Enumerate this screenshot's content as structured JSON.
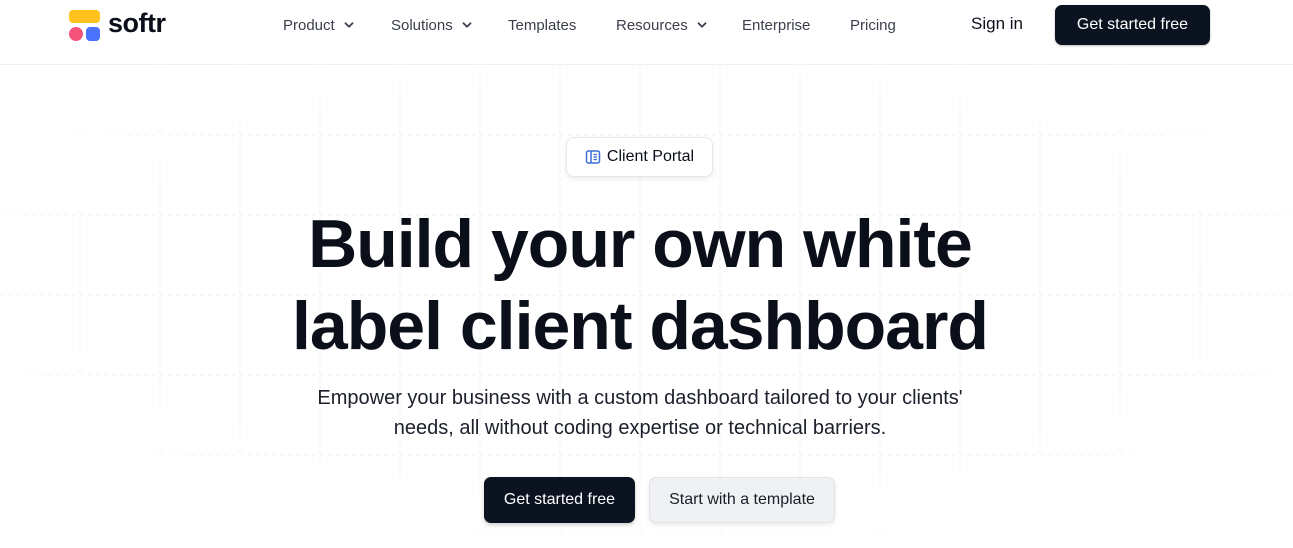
{
  "header": {
    "logo_text": "softr",
    "nav": [
      {
        "label": "Product",
        "has_dropdown": true
      },
      {
        "label": "Solutions",
        "has_dropdown": true
      },
      {
        "label": "Templates",
        "has_dropdown": false
      },
      {
        "label": "Resources",
        "has_dropdown": true
      },
      {
        "label": "Enterprise",
        "has_dropdown": false
      },
      {
        "label": "Pricing",
        "has_dropdown": false
      }
    ],
    "sign_in": "Sign in",
    "cta": "Get started free"
  },
  "hero": {
    "badge": {
      "label": "Client Portal",
      "icon": "book-open-icon"
    },
    "title": "Build your own white label client dashboard",
    "subtitle": "Empower your business with a custom dashboard tailored to your clients' needs, all without coding expertise or technical barriers.",
    "primary_button": "Get started free",
    "secondary_button": "Start with a template"
  },
  "colors": {
    "brand_dark": "#0b1220",
    "logo_yellow": "#ffc21f",
    "logo_pink": "#f7537a",
    "logo_blue": "#4b73ff",
    "badge_icon_blue": "#3b6fd9"
  }
}
